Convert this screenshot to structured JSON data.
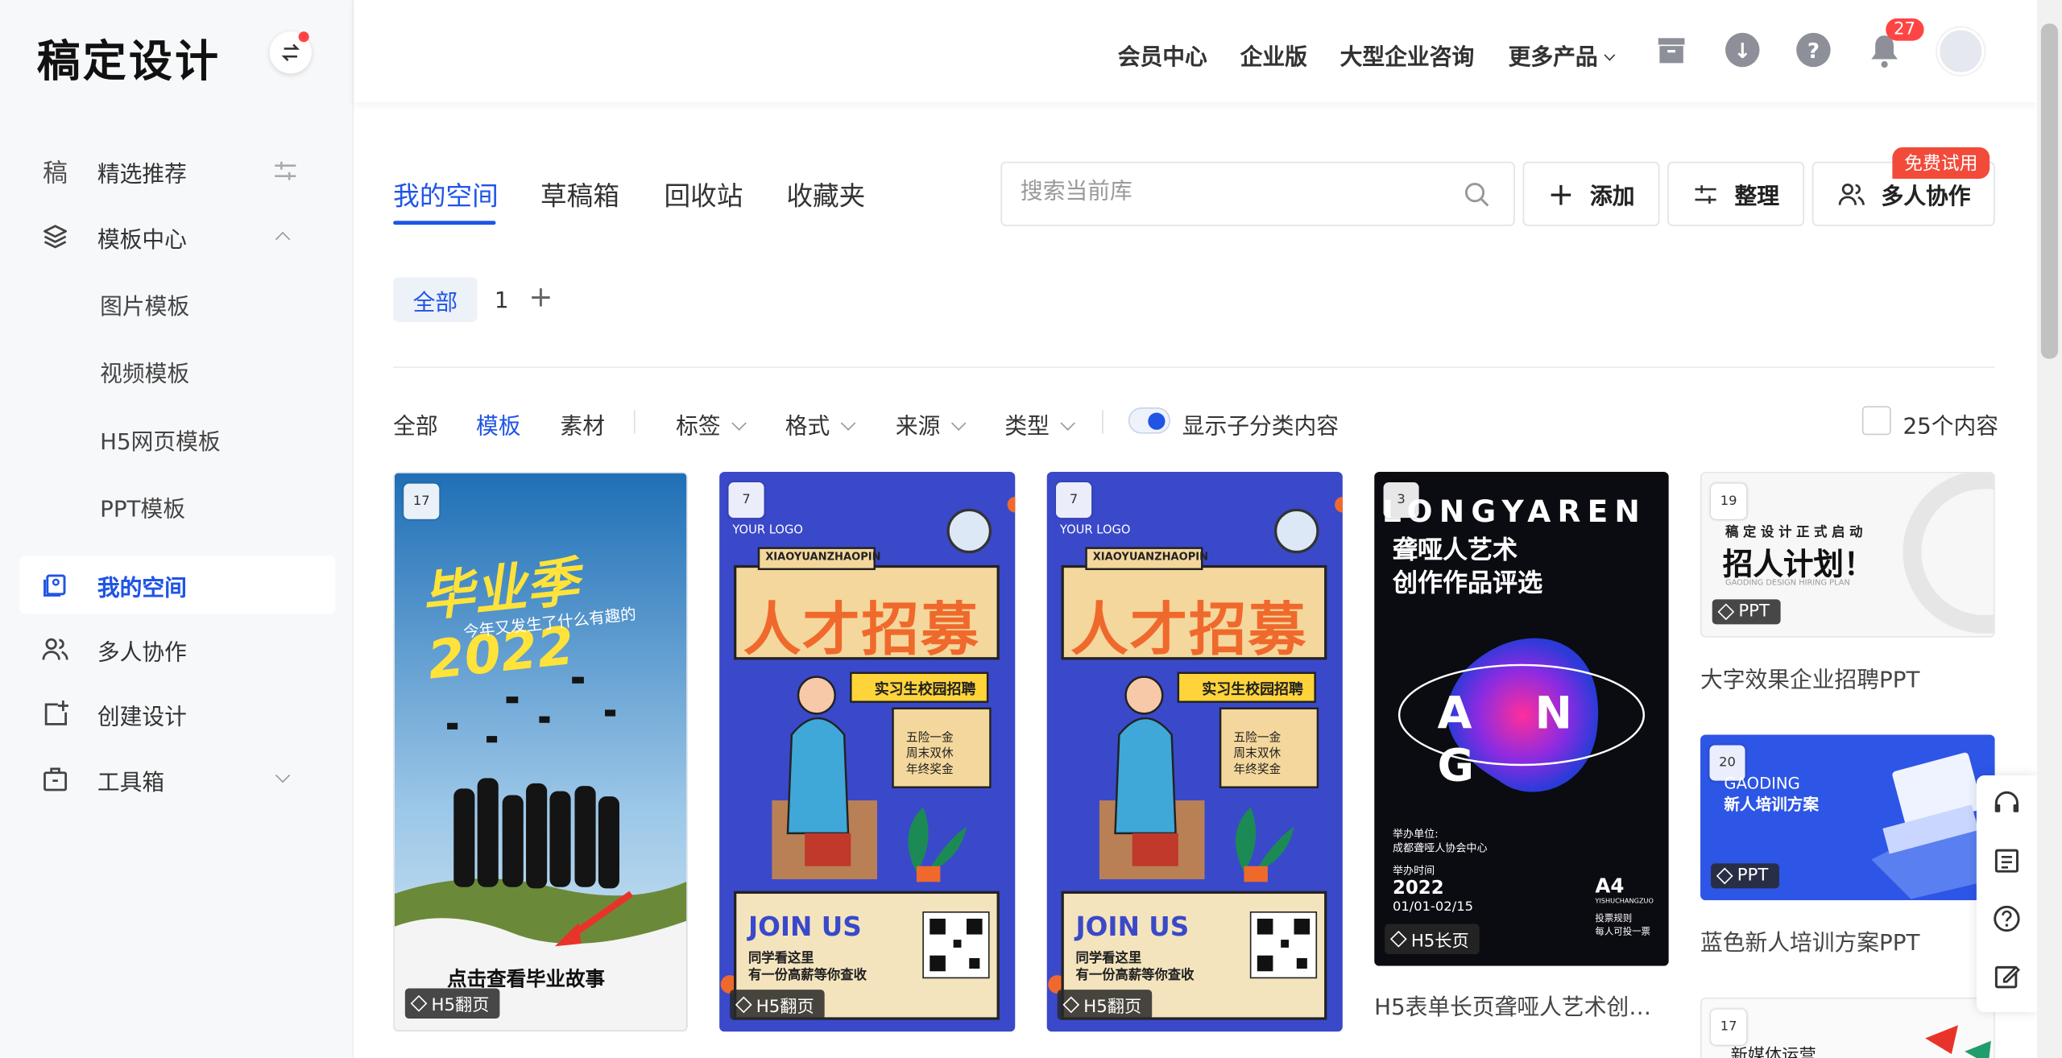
{
  "sidebar": {
    "logo": "稿定设计",
    "items": [
      {
        "label": "精选推荐",
        "icon": "gao-glyph-icon",
        "glyph": "稿"
      },
      {
        "label": "模板中心",
        "icon": "layers-icon"
      },
      {
        "label": "图片模板"
      },
      {
        "label": "视频模板"
      },
      {
        "label": "H5网页模板"
      },
      {
        "label": "PPT模板"
      },
      {
        "label": "我的空间",
        "icon": "my-space-icon"
      },
      {
        "label": "多人协作",
        "icon": "users-icon"
      },
      {
        "label": "创建设计",
        "icon": "create-design-icon"
      },
      {
        "label": "工具箱",
        "icon": "toolbox-icon"
      }
    ]
  },
  "header": {
    "links": [
      "会员中心",
      "企业版",
      "大型企业咨询",
      "更多产品"
    ],
    "notification_count": "27",
    "icons": [
      "trash-icon",
      "download-icon",
      "help-icon",
      "bell-icon",
      "avatar"
    ]
  },
  "tabs": [
    "我的空间",
    "草稿箱",
    "回收站",
    "收藏夹"
  ],
  "search": {
    "placeholder": "搜索当前库"
  },
  "actions": {
    "add": "添加",
    "organize": "整理",
    "collab": "多人协作",
    "trial": "免费试用"
  },
  "folders": {
    "all": "全部",
    "one": "1",
    "add": "+"
  },
  "filters": {
    "all": "全部",
    "template": "模板",
    "material": "素材",
    "tag": "标签",
    "format": "格式",
    "source": "来源",
    "type": "类型",
    "show_sub": "显示子分类内容",
    "count": "25个内容"
  },
  "cards": [
    {
      "count": "17",
      "tag": "H5翻页",
      "poster_title": "毕业季 2022",
      "poster_sub": "今年又发生了什么有趣的",
      "poster_cta": "点击查看毕业故事"
    },
    {
      "count": "7",
      "tag": "H5翻页",
      "logo": "YOUR LOGO",
      "brand": "XIAOYUANZHAOPIN",
      "headline": "人才招募",
      "ribbon": "实习生校园招聘",
      "perks": [
        "五险一金",
        "周末双休",
        "年终奖金"
      ],
      "join": "JOIN US",
      "join_sub1": "同学看这里",
      "join_sub2": "有一份高薪等你查收"
    },
    {
      "count": "7",
      "tag": "H5翻页",
      "logo": "YOUR LOGO",
      "brand": "XIAOYUANZHAOPIN",
      "headline": "人才招募",
      "ribbon": "实习生校园招聘",
      "perks": [
        "五险一金",
        "周末双休",
        "年终奖金"
      ],
      "join": "JOIN US",
      "join_sub1": "同学看这里",
      "join_sub2": "有一份高薪等你查收"
    },
    {
      "count": "3",
      "tag": "H5长页",
      "top": "LONGYAREN",
      "title1": "聋哑人艺术",
      "title2": "创作作品评选",
      "letters": "A N G",
      "org_label": "举办单位:",
      "org": "成都聋哑人协会中心",
      "time_label": "举办时间",
      "year": "2022",
      "dates": "01/01-02/15",
      "size": "A4",
      "size_sub": "YISHUCHANGZUO",
      "rule1": "投票规则",
      "rule2": "每人可投一票",
      "title": "H5表单长页聋哑人艺术创作..."
    },
    {
      "count": "19",
      "tag": "PPT",
      "line1": "稿 定 设 计 正 式 启 动",
      "line2": "招人计划！",
      "line3": "GAODING DESIGN HIRING PLAN",
      "title": "大字效果企业招聘PPT"
    },
    {
      "count": "20",
      "tag": "PPT",
      "line1": "GAODING",
      "line2": "新人培训方案",
      "title": "蓝色新人培训方案PPT"
    },
    {
      "count": "17",
      "line1": "新媒体运营"
    }
  ],
  "colors": {
    "accent": "#1f54e6",
    "trial": "#f24b3a",
    "recruit_bg": "#3a49c9",
    "recruit_title": "#f0692c"
  }
}
